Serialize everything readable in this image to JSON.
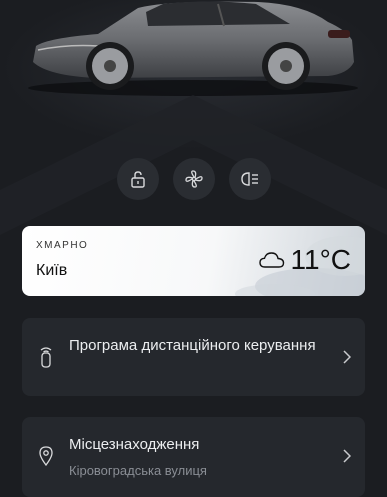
{
  "hero": {
    "car_image": "car-image"
  },
  "quick_actions": [
    {
      "icon": "lock-open-icon"
    },
    {
      "icon": "fan-icon"
    },
    {
      "icon": "headlights-icon"
    }
  ],
  "weather": {
    "condition": "ХМАРНО",
    "city": "Київ",
    "temperature": "11°C",
    "icon": "cloud-icon"
  },
  "cards": {
    "remote": {
      "title": "Програма дистанційного керування",
      "icon": "key-fob-icon"
    },
    "location": {
      "title": "Місцезнаходження",
      "subtitle": "Кіровоградська вулиця",
      "icon": "location-pin-icon"
    }
  },
  "colors": {
    "background": "#1b1d21",
    "card": "#25282d",
    "weather_card": "#ffffff"
  }
}
